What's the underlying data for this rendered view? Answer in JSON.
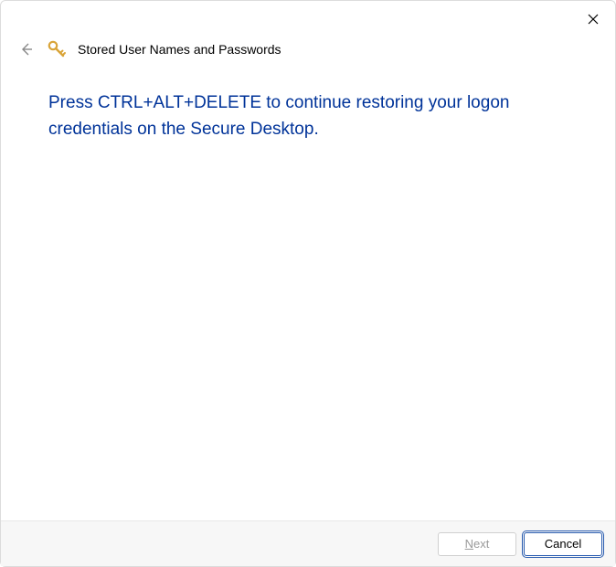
{
  "header": {
    "title": "Stored User Names and Passwords"
  },
  "content": {
    "instruction": "Press CTRL+ALT+DELETE to continue restoring your logon credentials on the Secure Desktop."
  },
  "footer": {
    "next_prefix": "N",
    "next_rest": "ext",
    "cancel_label": "Cancel"
  }
}
